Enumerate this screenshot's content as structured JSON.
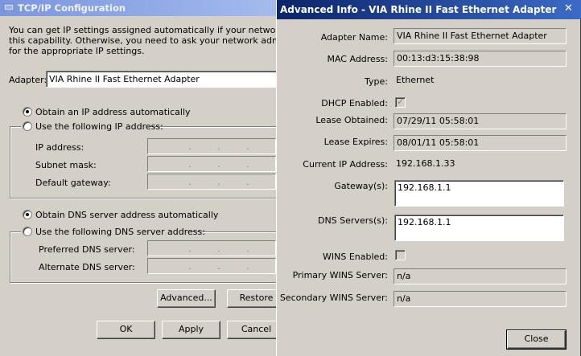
{
  "tcp": {
    "title": "TCP/IP Configuration",
    "description_lines": [
      "You can get IP settings assigned automatically if your network suppor",
      "this capability. Otherwise, you need to ask your network administrato",
      "for the appropriate IP settings."
    ],
    "adapter_label": "Adapter:",
    "adapter_value": "VIA Rhine II Fast Ethernet Adapter",
    "ip_auto_label": "Obtain an IP address automatically",
    "ip_auto_selected": true,
    "ip_manual_label": "Use the following IP address:",
    "ip_address_label": "IP address:",
    "subnet_mask_label": "Subnet mask:",
    "default_gateway_label": "Default gateway:",
    "dns_auto_label": "Obtain DNS server address automatically",
    "dns_auto_selected": true,
    "dns_manual_label": "Use the following DNS server address:",
    "preferred_dns_label": "Preferred DNS server:",
    "alternate_dns_label": "Alternate DNS server:",
    "advanced_button": "Advanced...",
    "restore_button": "Restore",
    "ok_button": "OK",
    "apply_button": "Apply",
    "cancel_button": "Cancel"
  },
  "advanced": {
    "title": "Advanced Info - VIA Rhine II Fast Ethernet Adapter",
    "adapter_name_label": "Adapter Name:",
    "adapter_name_value": "VIA Rhine II Fast Ethernet Adapter",
    "mac_label": "MAC Address:",
    "mac_value": "00:13:d3:15:38:98",
    "type_label": "Type:",
    "type_value": "Ethernet",
    "dhcp_label": "DHCP Enabled:",
    "dhcp_enabled": true,
    "lease_obtained_label": "Lease Obtained:",
    "lease_obtained_value": "07/29/11 05:58:01",
    "lease_expires_label": "Lease Expires:",
    "lease_expires_value": "08/01/11 05:58:01",
    "current_ip_label": "Current IP Address:",
    "current_ip_value": "192.168.1.33",
    "gateways_label": "Gateway(s):",
    "gateways_value": "192.168.1.1",
    "dns_servers_label": "DNS Servers(s):",
    "dns_servers_value": "192.168.1.1",
    "wins_label": "WINS Enabled:",
    "wins_enabled": false,
    "primary_wins_label": "Primary WINS Server:",
    "primary_wins_value": "n/a",
    "secondary_wins_label": "Secondary WINS Server:",
    "secondary_wins_value": "n/a",
    "close_button": "Close"
  }
}
